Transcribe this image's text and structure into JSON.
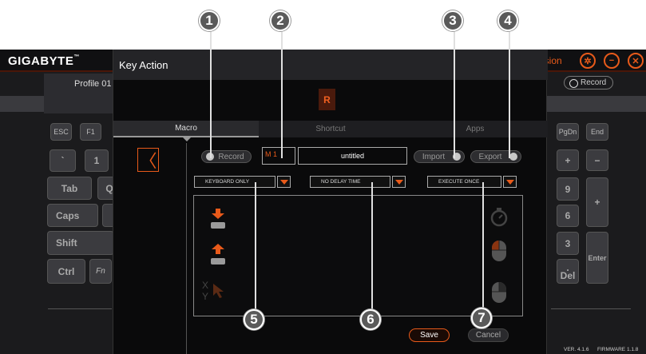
{
  "app": {
    "logo": "GIGABYTE",
    "logo_tm": "™",
    "brand_partial": "usion",
    "profile": "Profile 01",
    "record_label": "Record",
    "version": "VER. 4.1.6",
    "firmware": "FIRMWARE 1.1.8",
    "keys": {
      "esc": "ESC",
      "f1": "F1",
      "tilde": "`",
      "one": "1",
      "tab": "Tab",
      "q": "Q",
      "caps": "Caps",
      "shift": "Shift",
      "ctrl": "Ctrl",
      "fn": "Fn",
      "pgdn": "PgDn",
      "end": "End",
      "plus": "+",
      "minus": "−",
      "nine": "9",
      "six": "6",
      "three": "3",
      "enter": "Enter",
      "del_dot": ".",
      "del": "Del",
      "numplus": "+"
    }
  },
  "dialog": {
    "title": "Key Action",
    "key_badge": "R",
    "tabs": [
      "Macro",
      "Shortcut",
      "Apps"
    ],
    "back_glyph": "〈",
    "record": "Record",
    "macro_id": "M 1",
    "macro_name": "untitled",
    "import": "Import",
    "export": "Export",
    "dropdowns": [
      "KEYBOARD ONLY",
      "NO DELAY TIME",
      "EXECUTE ONCE"
    ],
    "xy_x": "X",
    "xy_y": "Y",
    "save": "Save",
    "cancel": "Cancel"
  },
  "callouts": [
    "1",
    "2",
    "3",
    "4",
    "5",
    "6",
    "7"
  ],
  "colors": {
    "accent": "#e85a1a",
    "background": "#0a0a0b"
  },
  "icons": [
    "key-down-arrow-icon",
    "key-up-arrow-icon",
    "mouse-cursor-icon",
    "stopwatch-icon",
    "mouse-left-click-icon",
    "mouse-right-click-icon"
  ]
}
